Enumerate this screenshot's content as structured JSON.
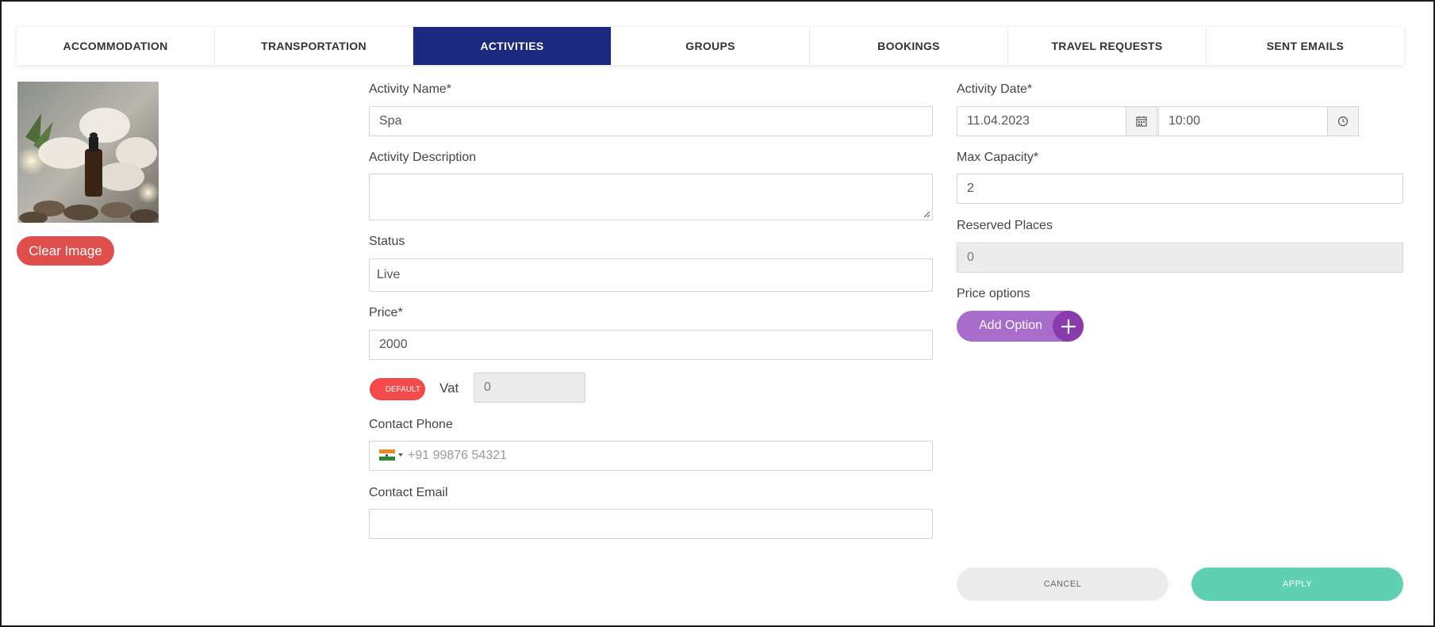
{
  "tabs": [
    {
      "label": "ACCOMMODATION",
      "active": false
    },
    {
      "label": "TRANSPORTATION",
      "active": false
    },
    {
      "label": "ACTIVITIES",
      "active": true
    },
    {
      "label": "GROUPS",
      "active": false
    },
    {
      "label": "BOOKINGS",
      "active": false
    },
    {
      "label": "TRAVEL REQUESTS",
      "active": false
    },
    {
      "label": "SENT EMAILS",
      "active": false
    }
  ],
  "image": {
    "clear_label": "Clear Image"
  },
  "form": {
    "activity_name": {
      "label": "Activity Name*",
      "value": "Spa"
    },
    "activity_description": {
      "label": "Activity Description",
      "value": ""
    },
    "status": {
      "label": "Status",
      "value": "Live"
    },
    "price": {
      "label": "Price*",
      "value": "2000"
    },
    "toggle_label": "DEFAULT",
    "vat": {
      "label": "Vat",
      "value": "0"
    },
    "contact_phone": {
      "label": "Contact Phone",
      "placeholder": "+91 99876 54321"
    },
    "contact_email": {
      "label": "Contact Email",
      "value": ""
    },
    "activity_date": {
      "label": "Activity Date*",
      "date": "11.04.2023",
      "time": "10:00"
    },
    "max_capacity": {
      "label": "Max Capacity*",
      "value": "2"
    },
    "reserved_places": {
      "label": "Reserved Places",
      "value": "0"
    },
    "price_options": {
      "label": "Price options",
      "add_label": "Add Option"
    }
  },
  "actions": {
    "cancel": "CANCEL",
    "apply": "APPLY"
  },
  "colors": {
    "active_tab": "#1b2a7f",
    "clear_button": "#dd4e4d",
    "toggle": "#f44a4a",
    "add_option": "#a86ccb",
    "add_option_plus": "#8a3aad",
    "apply": "#5fd0b0"
  }
}
